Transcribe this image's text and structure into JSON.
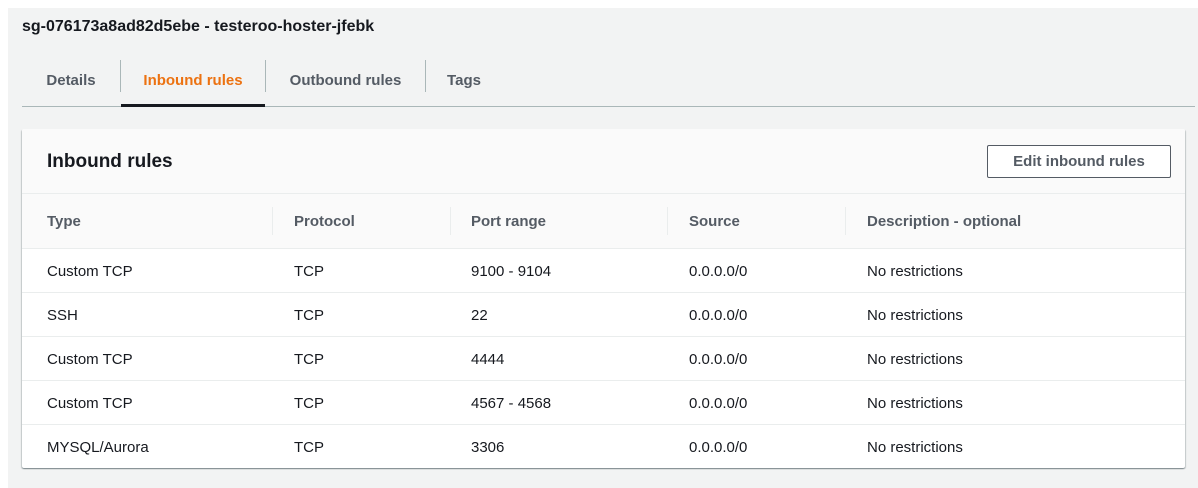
{
  "security_group": {
    "title": "sg-076173a8ad82d5ebe - testeroo-hoster-jfebk"
  },
  "tabs": [
    {
      "label": "Details",
      "active": false
    },
    {
      "label": "Inbound rules",
      "active": true
    },
    {
      "label": "Outbound rules",
      "active": false
    },
    {
      "label": "Tags",
      "active": false
    }
  ],
  "inbound": {
    "title": "Inbound rules",
    "edit_button_label": "Edit inbound rules",
    "columns": [
      "Type",
      "Protocol",
      "Port range",
      "Source",
      "Description - optional"
    ],
    "rows": [
      [
        "Custom TCP",
        "TCP",
        "9100 - 9104",
        "0.0.0.0/0",
        "No restrictions"
      ],
      [
        "SSH",
        "TCP",
        "22",
        "0.0.0.0/0",
        "No restrictions"
      ],
      [
        "Custom TCP",
        "TCP",
        "4444",
        "0.0.0.0/0",
        "No restrictions"
      ],
      [
        "Custom TCP",
        "TCP",
        "4567 - 4568",
        "0.0.0.0/0",
        "No restrictions"
      ],
      [
        "MYSQL/Aurora",
        "TCP",
        "3306",
        "0.0.0.0/0",
        "No restrictions"
      ]
    ]
  },
  "colors": {
    "accent": "#ec7211",
    "text": "#16191f",
    "muted": "#545b64",
    "background": "#f2f3f3"
  }
}
